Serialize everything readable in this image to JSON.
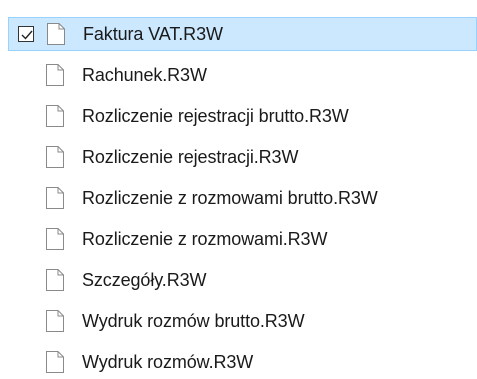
{
  "files": [
    {
      "name": "Faktura VAT.R3W",
      "selected": true,
      "checked": true
    },
    {
      "name": "Rachunek.R3W",
      "selected": false,
      "checked": false
    },
    {
      "name": "Rozliczenie rejestracji brutto.R3W",
      "selected": false,
      "checked": false
    },
    {
      "name": "Rozliczenie rejestracji.R3W",
      "selected": false,
      "checked": false
    },
    {
      "name": "Rozliczenie z rozmowami brutto.R3W",
      "selected": false,
      "checked": false
    },
    {
      "name": "Rozliczenie z rozmowami.R3W",
      "selected": false,
      "checked": false
    },
    {
      "name": "Szczegóły.R3W",
      "selected": false,
      "checked": false
    },
    {
      "name": "Wydruk rozmów brutto.R3W",
      "selected": false,
      "checked": false
    },
    {
      "name": "Wydruk rozmów.R3W",
      "selected": false,
      "checked": false
    }
  ],
  "icons": {
    "file": "file-icon",
    "checkbox": "checkbox-icon",
    "checkmark": "checkmark-icon"
  },
  "colors": {
    "selection_bg": "#cce8ff",
    "selection_border": "#99d1ff",
    "text": "#1a1a1a"
  }
}
